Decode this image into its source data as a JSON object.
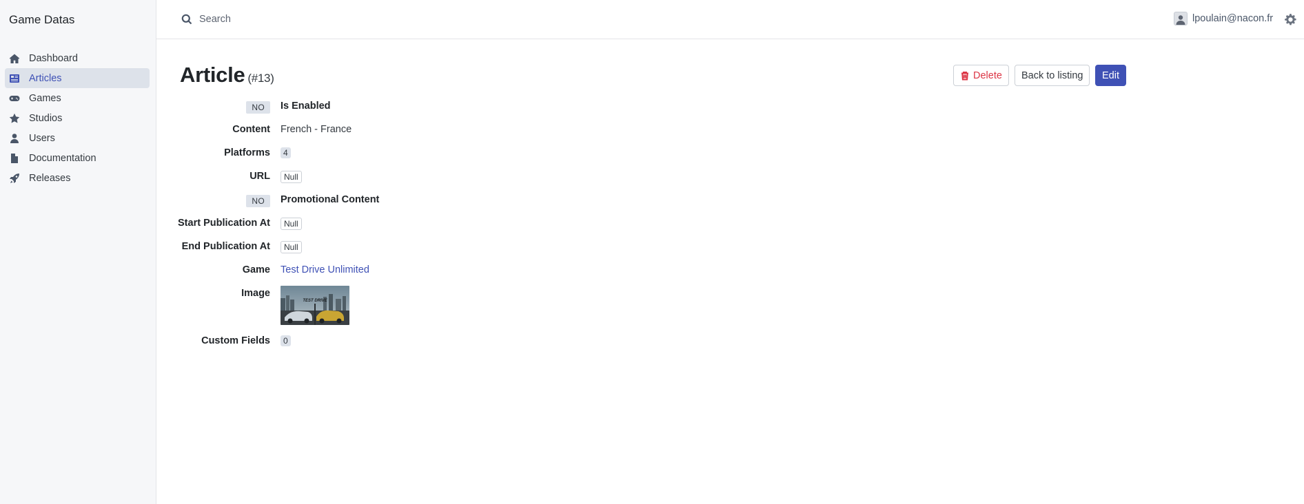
{
  "app": {
    "brand": "Game Datas"
  },
  "sidebar": {
    "items": [
      {
        "label": "Dashboard",
        "icon": "home-icon",
        "active": false
      },
      {
        "label": "Articles",
        "icon": "newspaper-icon",
        "active": true
      },
      {
        "label": "Games",
        "icon": "gamepad-icon",
        "active": false
      },
      {
        "label": "Studios",
        "icon": "star-icon",
        "active": false
      },
      {
        "label": "Users",
        "icon": "user-icon",
        "active": false
      },
      {
        "label": "Documentation",
        "icon": "document-icon",
        "active": false
      },
      {
        "label": "Releases",
        "icon": "rocket-icon",
        "active": false
      }
    ]
  },
  "topbar": {
    "search_placeholder": "Search",
    "user_email": "lpoulain@nacon.fr"
  },
  "page": {
    "title": "Article",
    "record_id": "(#13)",
    "actions": {
      "delete": "Delete",
      "back": "Back to listing",
      "edit": "Edit"
    }
  },
  "fields": {
    "is_enabled": {
      "badge": "NO",
      "label": "Is Enabled"
    },
    "content": {
      "label": "Content",
      "value": "French - France"
    },
    "platforms": {
      "label": "Platforms",
      "value": "4"
    },
    "url": {
      "label": "URL",
      "value": "Null"
    },
    "promotional": {
      "badge": "NO",
      "label": "Promotional Content"
    },
    "start_publication": {
      "label": "Start Publication At",
      "value": "Null"
    },
    "end_publication": {
      "label": "End Publication At",
      "value": "Null"
    },
    "game": {
      "label": "Game",
      "value": "Test Drive Unlimited"
    },
    "image": {
      "label": "Image",
      "thumb_text": "TEST DRIVE"
    },
    "custom_fields": {
      "label": "Custom Fields",
      "value": "0"
    }
  },
  "colors": {
    "primary": "#3f51b5",
    "danger": "#dc3545",
    "sidebar_bg": "#f6f7f9",
    "active_bg": "#dde2ea"
  }
}
